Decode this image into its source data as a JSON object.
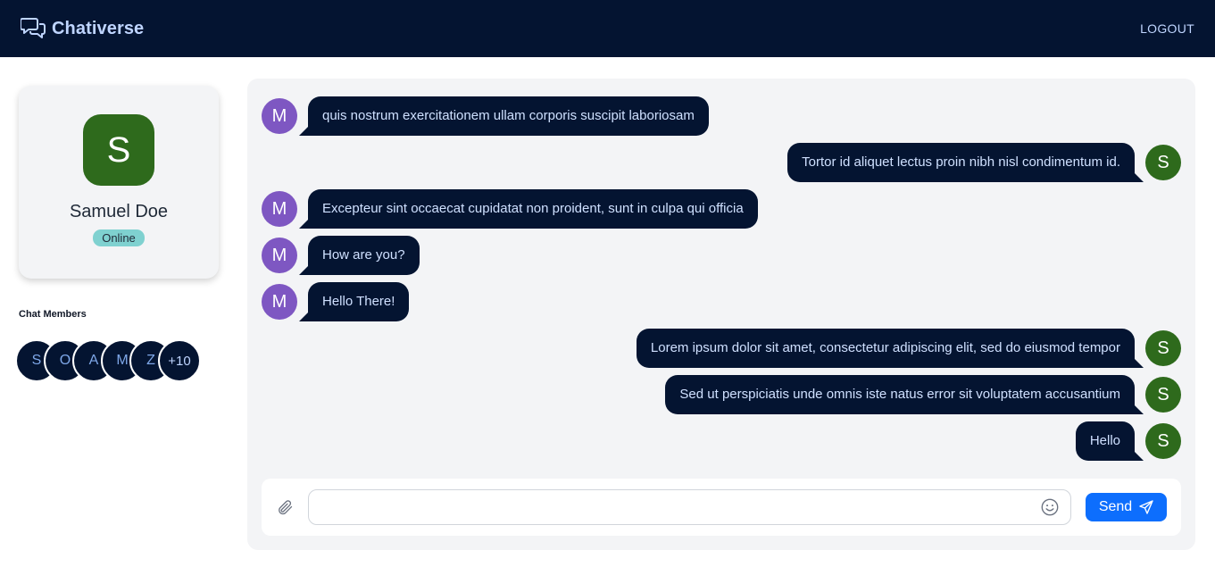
{
  "header": {
    "app_name": "Chativerse",
    "logout_label": "LOGOUT"
  },
  "profile": {
    "avatar_letter": "S",
    "name": "Samuel Doe",
    "status": "Online"
  },
  "members": {
    "title": "Chat Members",
    "avatars": [
      "S",
      "O",
      "A",
      "M",
      "Z"
    ],
    "more": "+10"
  },
  "messages": [
    {
      "direction": "in",
      "avatar": "M",
      "text": "quis nostrum exercitationem ullam corporis suscipit laboriosam"
    },
    {
      "direction": "out",
      "avatar": "S",
      "text": "Tortor id aliquet lectus proin nibh nisl condimentum id."
    },
    {
      "direction": "in",
      "avatar": "M",
      "text": "Excepteur sint occaecat cupidatat non proident, sunt in culpa qui officia"
    },
    {
      "direction": "in",
      "avatar": "M",
      "text": "How are you?"
    },
    {
      "direction": "in",
      "avatar": "M",
      "text": "Hello There!"
    },
    {
      "direction": "out",
      "avatar": "S",
      "text": "Lorem ipsum dolor sit amet, consectetur adipiscing elit, sed do eiusmod tempor"
    },
    {
      "direction": "out",
      "avatar": "S",
      "text": "Sed ut perspiciatis unde omnis iste natus error sit voluptatem accusantium"
    },
    {
      "direction": "out",
      "avatar": "S",
      "text": "Hello"
    }
  ],
  "composer": {
    "input_value": "",
    "placeholder": "",
    "send_label": "Send"
  },
  "colors": {
    "header_bg": "#041431",
    "bubble_bg": "#041431",
    "avatar_m": "#7e57c2",
    "avatar_s": "#2e6a1c",
    "status_badge": "#7fd1d0",
    "send_button": "#0d6efd"
  },
  "icons": {
    "brand": "chat-bubbles-icon",
    "attach": "paperclip-icon",
    "emoji": "smiley-icon",
    "send": "paper-plane-icon"
  }
}
